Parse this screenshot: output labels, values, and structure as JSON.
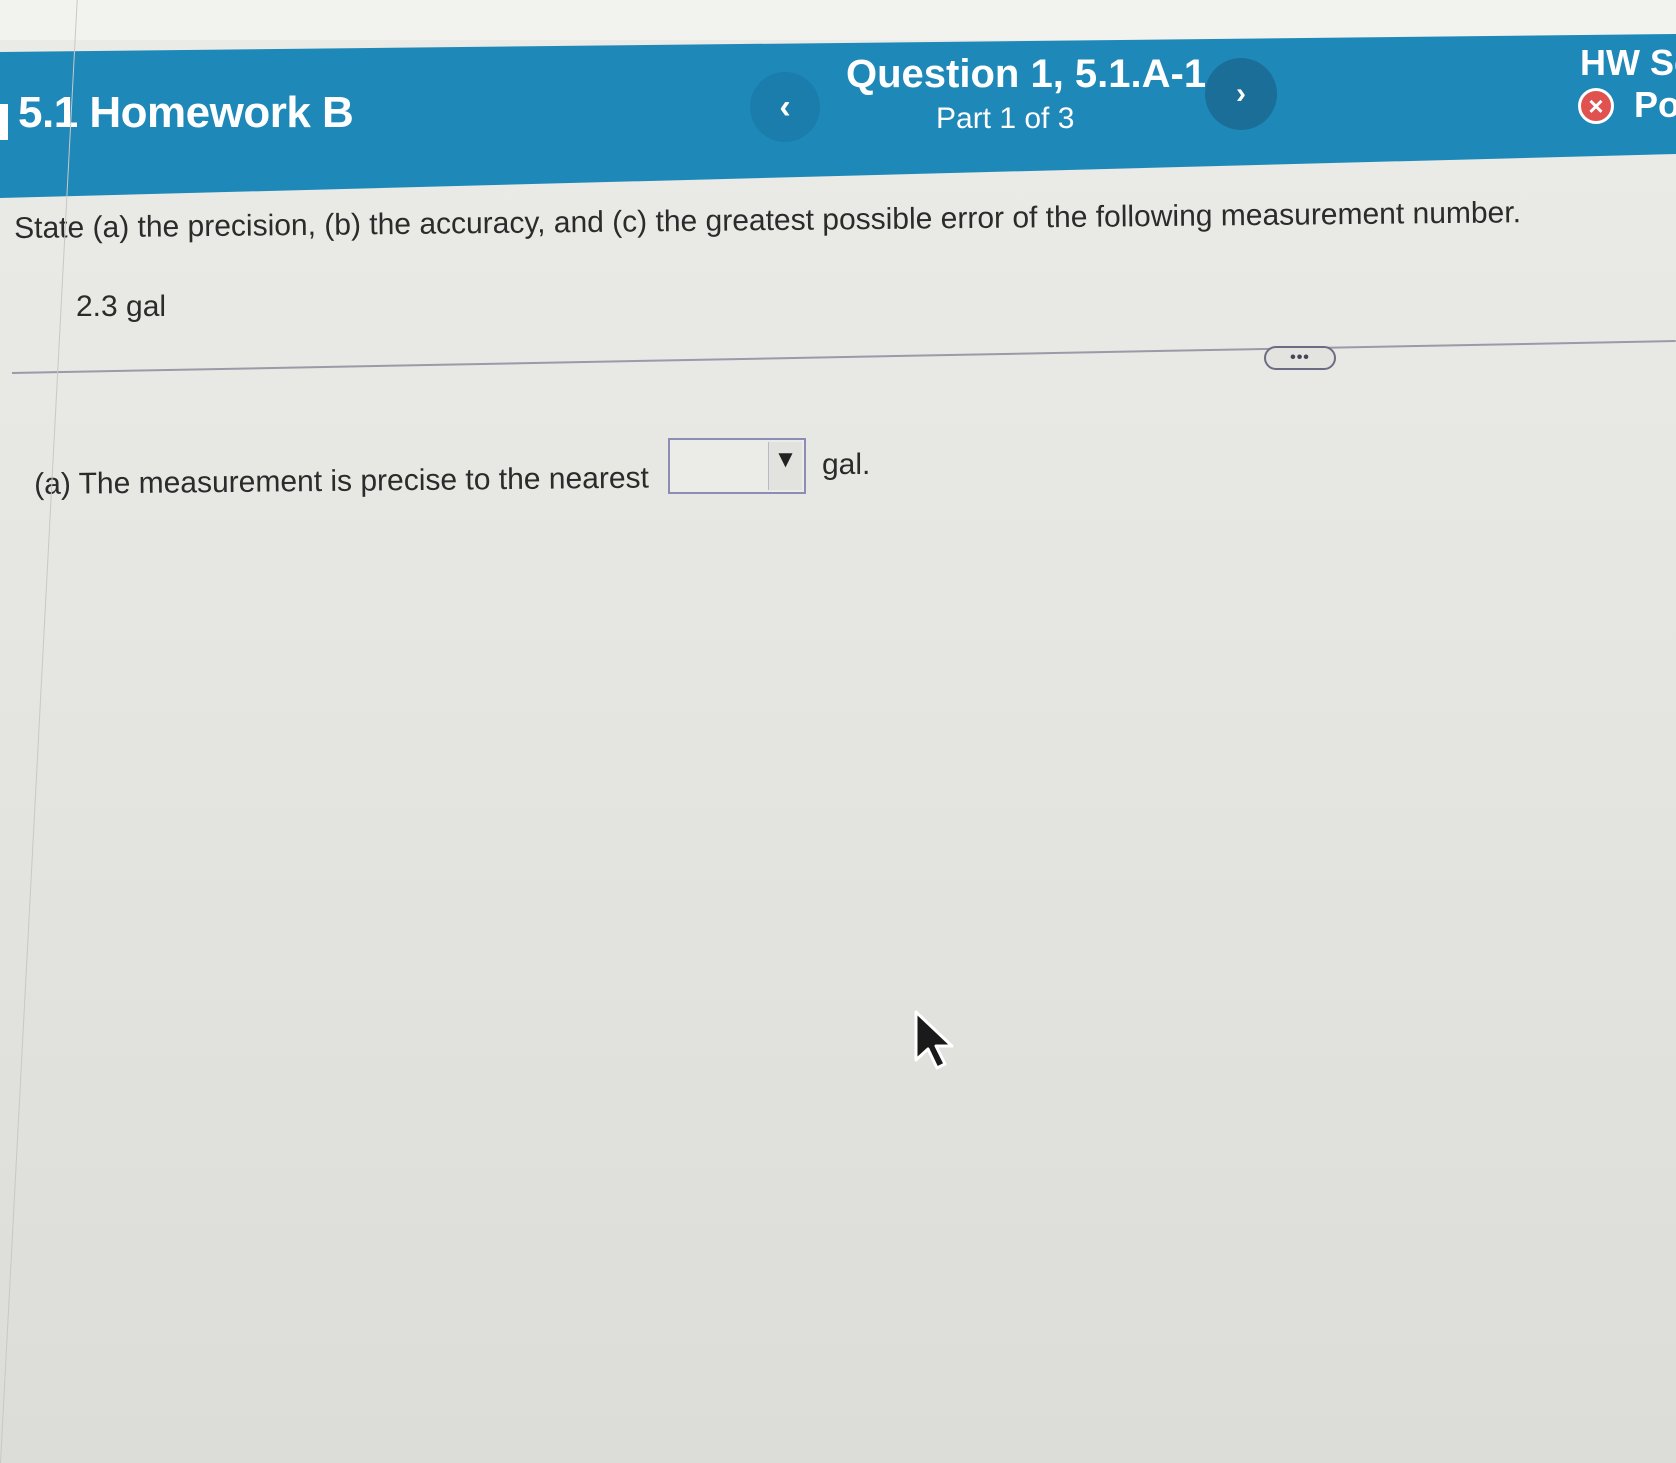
{
  "header": {
    "assignment_title": "5.1 Homework B",
    "question_title": "Question 1, 5.1.A-1",
    "question_part": "Part 1 of 3",
    "prev_label": "‹",
    "next_label": "›",
    "score_label": "HW Sc",
    "points_label": "Po",
    "points_icon": "x-circle-icon",
    "points_icon_glyph": "×"
  },
  "question": {
    "instruction": "State (a) the precision, (b) the accuracy, and (c) the greatest possible error of the following measurement number.",
    "measurement": "2.3 gal",
    "more_label": "•••"
  },
  "part_a": {
    "label": "(a) The measurement is precise to the nearest",
    "select_value": "",
    "select_arrow": "▼",
    "unit": "gal."
  },
  "colors": {
    "header_bg": "#1e88b8",
    "page_bg": "#e6e6e2",
    "error_red": "#e0524f"
  }
}
